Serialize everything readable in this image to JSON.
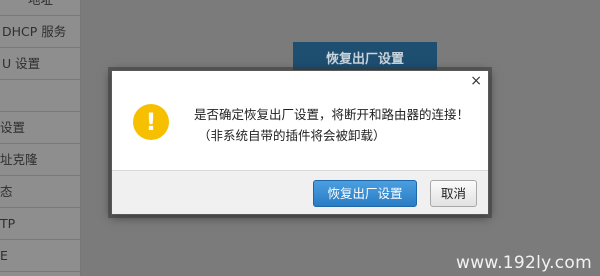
{
  "background": {
    "sidebar_items": [
      {
        "label": "地址"
      },
      {
        "label": "DHCP 服务"
      },
      {
        "label": "U 设置"
      },
      {
        "label": ""
      },
      {
        "label": "设置"
      },
      {
        "label": "址克隆"
      },
      {
        "label": "态"
      },
      {
        "label": "TP"
      },
      {
        "label": "E"
      }
    ],
    "reset_button_label": "恢复出厂设置"
  },
  "dialog": {
    "close_glyph": "×",
    "icon": "warning-icon",
    "icon_glyph": "!",
    "icon_color": "#f6c000",
    "message_line1": "是否确定恢复出厂设置，将断开和路由器的连接！",
    "message_line2": "（非系统自带的插件将会被卸载）",
    "confirm_label": "恢复出厂设置",
    "cancel_label": "取消",
    "accent_color": "#2a7cc4"
  },
  "watermark": "www.192ly.com"
}
